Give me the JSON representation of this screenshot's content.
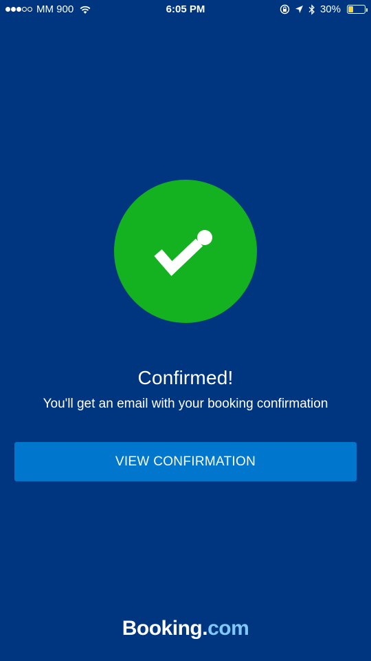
{
  "status_bar": {
    "carrier": "MM 900",
    "time": "6:05 PM",
    "battery_percent": "30%",
    "battery_level": 0.3,
    "signal_bars_filled": 3,
    "signal_bars_total": 5
  },
  "confirmation": {
    "title": "Confirmed!",
    "subtitle": "You'll get an email with your booking confirmation",
    "button_label": "VIEW CONFIRMATION"
  },
  "logo": {
    "brand": "Booking",
    "separator": ".",
    "suffix": "com"
  },
  "colors": {
    "background": "#003580",
    "success": "#14b120",
    "button": "#0077cc",
    "logo_suffix": "#7fc8f8",
    "battery": "#f8d33b"
  },
  "icons": [
    "wifi-icon",
    "lock-rotation-icon",
    "location-arrow-icon",
    "bluetooth-icon",
    "battery-icon",
    "checkmark-icon"
  ]
}
